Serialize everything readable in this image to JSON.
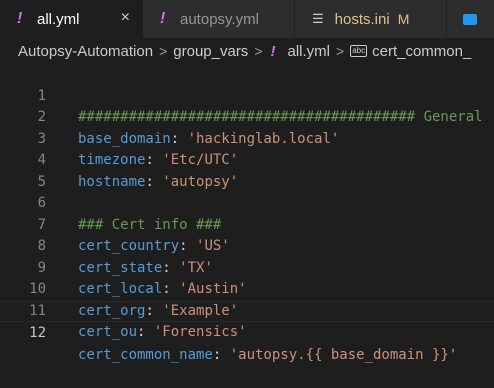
{
  "tabs": [
    {
      "label": "all.yml",
      "icon": "yaml-icon",
      "active": true,
      "close": "×"
    },
    {
      "label": "autopsy.yml",
      "icon": "yaml-icon",
      "active": false
    },
    {
      "label": "hosts.ini",
      "icon": "ini-icon",
      "active": false,
      "status": "M"
    }
  ],
  "breadcrumb": {
    "items": [
      "Autopsy-Automation",
      "group_vars",
      "all.yml",
      "cert_common_"
    ]
  },
  "editor": {
    "current_line": 12,
    "lines": [
      {
        "n": "1",
        "comment": "######################################## General"
      },
      {
        "n": "2",
        "key": "base_domain",
        "value": "'hackinglab.local'"
      },
      {
        "n": "3",
        "key": "timezone",
        "value": "'Etc/UTC'"
      },
      {
        "n": "4",
        "key": "hostname",
        "value": "'autopsy'"
      },
      {
        "n": "5"
      },
      {
        "n": "6",
        "comment": "### Cert info ###"
      },
      {
        "n": "7",
        "key": "cert_country",
        "value": "'US'"
      },
      {
        "n": "8",
        "key": "cert_state",
        "value": "'TX'"
      },
      {
        "n": "9",
        "key": "cert_local",
        "value": "'Austin'"
      },
      {
        "n": "10",
        "key": "cert_org",
        "value": "'Example'"
      },
      {
        "n": "11",
        "key": "cert_ou",
        "value": "'Forensics'"
      },
      {
        "n": "12",
        "key": "cert_common_name",
        "value": "'autopsy.{{ base_domain }}'"
      }
    ]
  },
  "colors": {
    "keyword": "#569cd6",
    "string": "#ce9178",
    "comment": "#6a9955",
    "yaml_icon": "#c678dd",
    "modified": "#e2c08d"
  }
}
